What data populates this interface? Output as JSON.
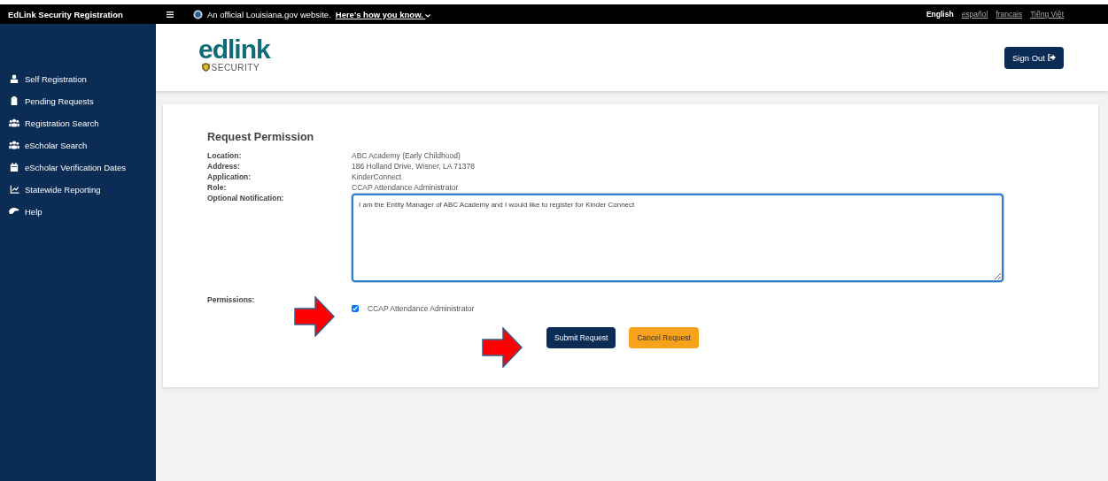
{
  "app_title": "EdLink Security Registration",
  "banner": {
    "text": "An official Louisiana.gov website.",
    "link": "Here's how you know."
  },
  "languages": [
    {
      "label": "English",
      "selected": true
    },
    {
      "label": "español",
      "selected": false
    },
    {
      "label": "francais",
      "selected": false
    },
    {
      "label": "Tiếng Việt",
      "selected": false
    }
  ],
  "sidebar": {
    "items": [
      {
        "label": "Self Registration"
      },
      {
        "label": "Pending Requests"
      },
      {
        "label": "Registration Search"
      },
      {
        "label": "eScholar Search"
      },
      {
        "label": "eScholar Verification Dates"
      },
      {
        "label": "Statewide Reporting"
      },
      {
        "label": "Help"
      }
    ]
  },
  "header": {
    "logo": "edlink",
    "logo_subtitle": "SECURITY",
    "sign_out": "Sign Out"
  },
  "form": {
    "title": "Request Permission",
    "fields": [
      {
        "label": "Location:",
        "value": "ABC Academy (Early Childhood)"
      },
      {
        "label": "Address:",
        "value": "186 Holland Drive, Wisner, LA 71378"
      },
      {
        "label": "Application:",
        "value": "KinderConnect"
      },
      {
        "label": "Role:",
        "value": "CCAP Attendance Administrator"
      }
    ],
    "notification": {
      "label": "Optional Notification:",
      "value": "I am the Entity Manager of ABC Academy and I would like to register for Kinder Connect"
    },
    "permissions": {
      "label": "Permissions:",
      "items": [
        {
          "label": "CCAP Attendance Administrator",
          "checked": true
        }
      ]
    },
    "buttons": [
      {
        "label": "Submit Request",
        "kind": "primary"
      },
      {
        "label": "Cancel Request",
        "kind": "warning"
      }
    ]
  }
}
